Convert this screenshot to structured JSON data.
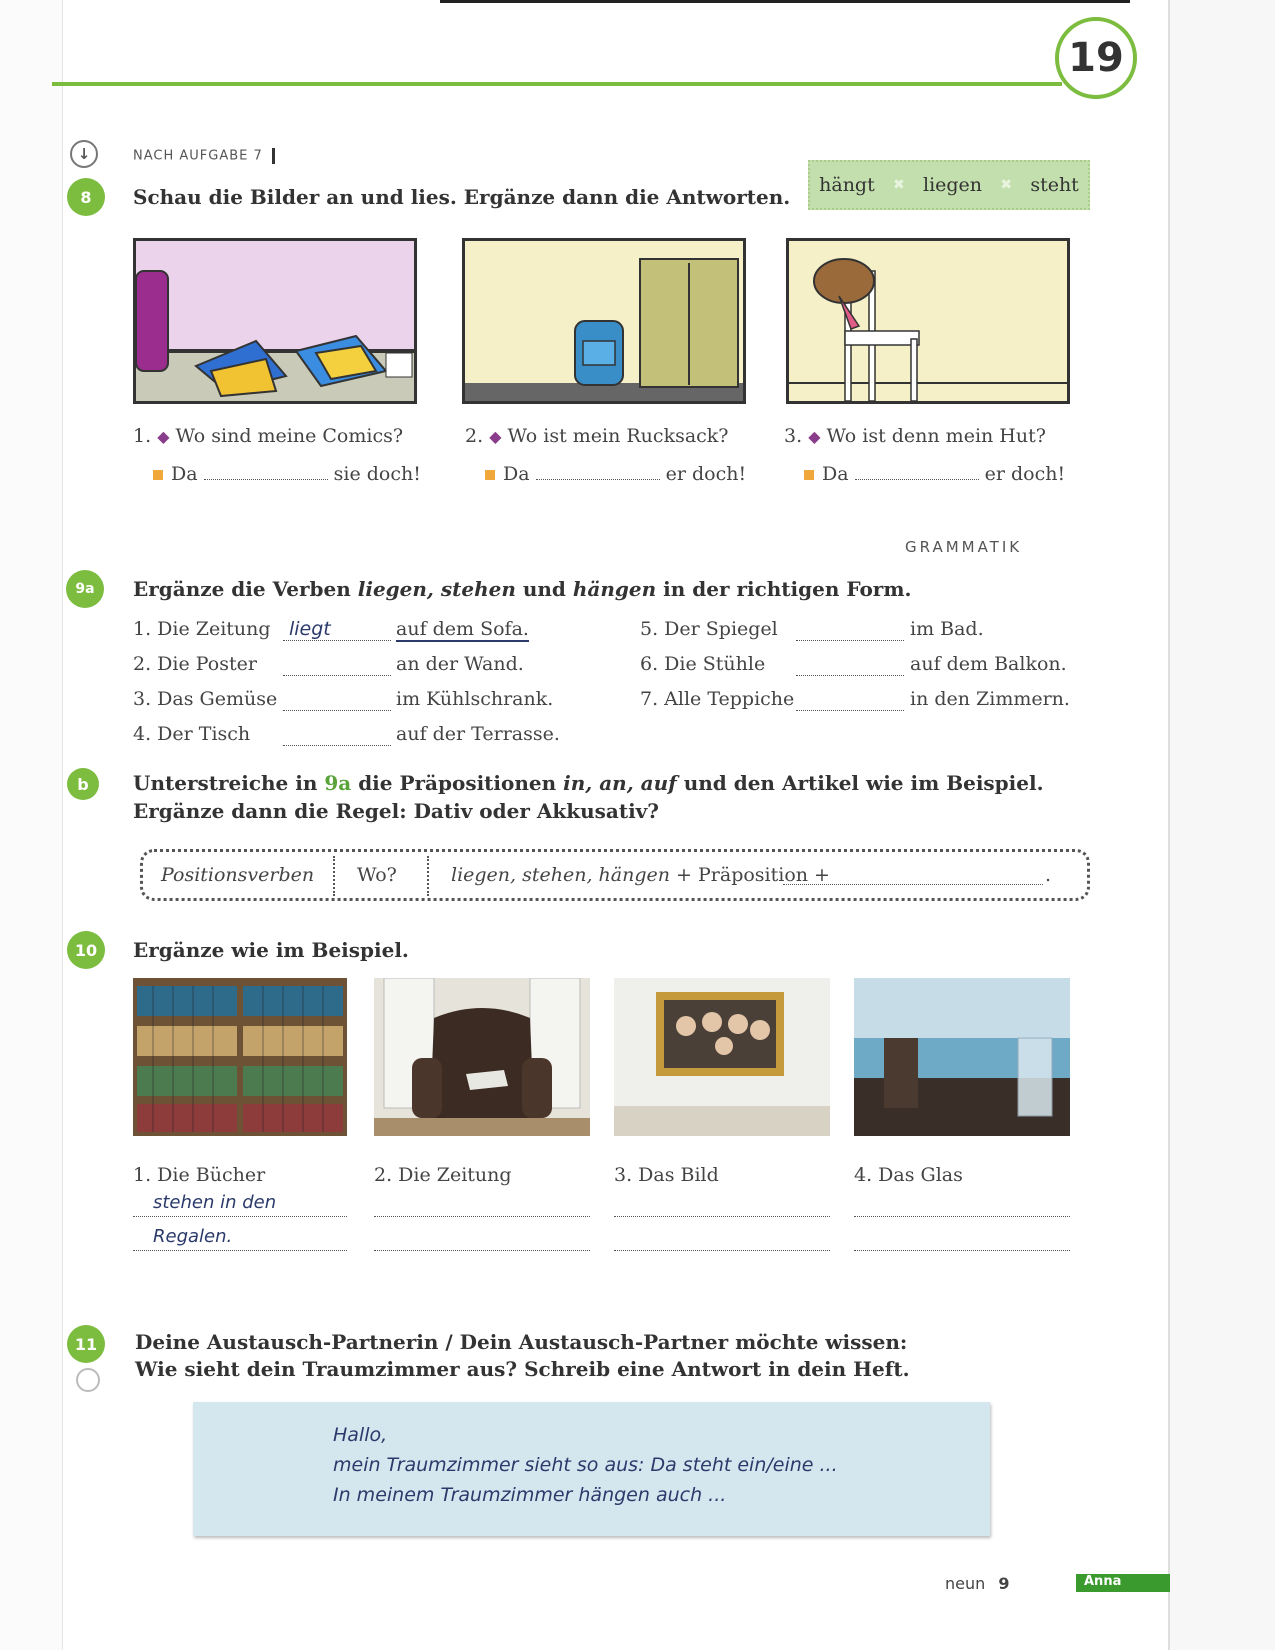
{
  "chapter_number": "19",
  "nach_aufgabe": "NACH AUFGABE 7",
  "ex8": {
    "number": "8",
    "instruction": "Schau die Bilder an und lies. Ergänze dann die Antworten.",
    "words": [
      "hängt",
      "liegen",
      "steht"
    ],
    "items": [
      {
        "num": "1.",
        "question": "Wo sind meine Comics?",
        "da": "Da",
        "end": "sie doch!"
      },
      {
        "num": "2.",
        "question": "Wo ist mein Rucksack?",
        "da": "Da",
        "end": "er doch!"
      },
      {
        "num": "3.",
        "question": "Wo ist denn mein Hut?",
        "da": "Da",
        "end": "er doch!"
      }
    ]
  },
  "grammatik_label": "GRAMMATIK",
  "ex9a": {
    "number": "9a",
    "instruction_parts": [
      "Ergänze die Verben ",
      "liegen, stehen",
      " und ",
      "hängen",
      " in der richtigen Form."
    ],
    "left": [
      {
        "subject": "1. Die Zeitung",
        "answer": "liegt",
        "place": "auf dem Sofa."
      },
      {
        "subject": "2. Die Poster",
        "answer": "",
        "place": "an der Wand."
      },
      {
        "subject": "3. Das Gemüse",
        "answer": "",
        "place": "im Kühlschrank."
      },
      {
        "subject": "4. Der Tisch",
        "answer": "",
        "place": "auf der Terrasse."
      }
    ],
    "right": [
      {
        "subject": "5. Der Spiegel",
        "place": "im Bad."
      },
      {
        "subject": "6. Die Stühle",
        "place": "auf dem Balkon."
      },
      {
        "subject": "7. Alle Teppiche",
        "place": "in den Zimmern."
      }
    ]
  },
  "ex9b": {
    "number": "b",
    "line1_a": "Unterstreiche in ",
    "line1_ref": "9a",
    "line1_b": " die Präpositionen ",
    "line1_preps": "in, an, auf",
    "line1_c": " und den Artikel wie im Beispiel.",
    "line2": "Ergänze dann die Regel: Dativ oder Akkusativ?",
    "rule_col1": "Positionsverben",
    "rule_col2": "Wo?",
    "rule_verbs": "liegen, stehen, hängen",
    "rule_plus": "+ Präposition +",
    "rule_end": "."
  },
  "ex10": {
    "number": "10",
    "instruction": "Ergänze wie im Beispiel.",
    "items": [
      {
        "label": "1. Die Bücher",
        "line1": "stehen in den",
        "line2": "Regalen."
      },
      {
        "label": "2. Die Zeitung",
        "line1": "",
        "line2": ""
      },
      {
        "label": "3. Das Bild",
        "line1": "",
        "line2": ""
      },
      {
        "label": "4. Das Glas",
        "line1": "",
        "line2": ""
      }
    ]
  },
  "ex11": {
    "number": "11",
    "line1": "Deine Austausch-Partnerin / Dein Austausch-Partner möchte wissen:",
    "line2": "Wie sieht dein Traumzimmer aus? Schreib eine Antwort in dein Heft.",
    "box_lines": [
      "Hallo,",
      "mein Traumzimmer sieht so aus: Da steht ein/eine ...",
      "In meinem Traumzimmer hängen auch ..."
    ]
  },
  "footer": {
    "word": "neun",
    "page": "9",
    "tab": "Anna"
  },
  "colors": {
    "accent_green": "#7cbc3f",
    "diamond_purple": "#8a3d8b",
    "bullet_orange": "#f0a83c",
    "write_box_blue": "#d4e6ee"
  }
}
